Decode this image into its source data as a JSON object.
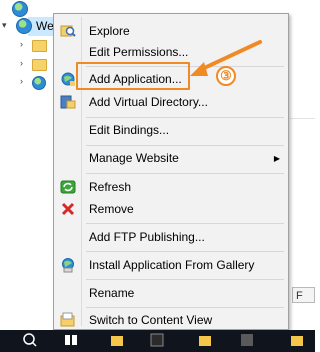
{
  "tree": {
    "site_label": "We"
  },
  "menu": {
    "items": [
      {
        "label": "Explore",
        "icon": "explore-icon"
      },
      {
        "label": "Edit Permissions...",
        "icon": ""
      },
      {
        "label": "Add Application...",
        "icon": "add-application-icon"
      },
      {
        "label": "Add Virtual Directory...",
        "icon": "add-virtual-directory-icon"
      },
      {
        "label": "Edit Bindings...",
        "icon": ""
      },
      {
        "label": "Manage Website",
        "icon": ""
      },
      {
        "label": "Refresh",
        "icon": "refresh-icon"
      },
      {
        "label": "Remove",
        "icon": "remove-icon"
      },
      {
        "label": "Add FTP Publishing...",
        "icon": ""
      },
      {
        "label": "Install Application From Gallery",
        "icon": "gallery-icon"
      },
      {
        "label": "Rename",
        "icon": ""
      },
      {
        "label": "Switch to Content View",
        "icon": "content-view-icon"
      }
    ]
  },
  "annotation": {
    "step_number": "③",
    "color": "#f08a24"
  },
  "status_tab": {
    "label": "F"
  }
}
